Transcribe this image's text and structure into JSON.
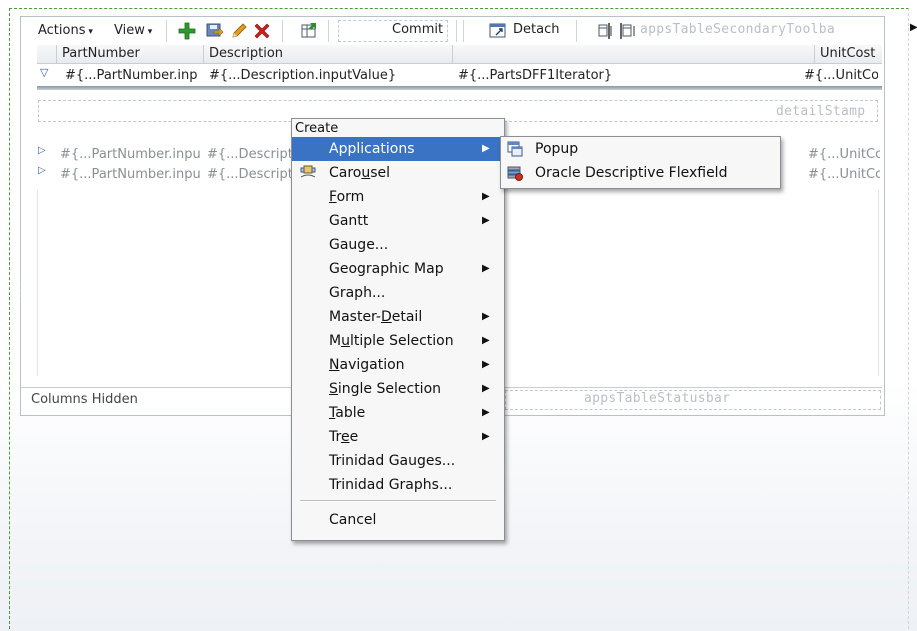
{
  "toolbar": {
    "actions_label": "Actions",
    "view_label": "View",
    "commit_label": "Commit",
    "detach_label": "Detach",
    "secondary_toolbar_label": "appsTableSecondaryToolba"
  },
  "table": {
    "columns": [
      "PartNumber",
      "Description",
      "",
      "UnitCost"
    ],
    "master_row": {
      "part": "#{...PartNumber.inp",
      "desc": "#{...Description.inputValue}",
      "iter": "#{...PartsDFF1Iterator}",
      "cost": "#{...UnitCo"
    },
    "detail_stamp_label": "detailStamp",
    "rows": [
      {
        "part": "#{...PartNumber.inpu",
        "desc": "#{...Descript",
        "cost": "#{...UnitCos"
      },
      {
        "part": "#{...PartNumber.inpu",
        "desc": "#{...Descript",
        "cost": "#{...UnitCos"
      }
    ],
    "status_left": "Columns Hidden",
    "statusbar_label": "appsTableStatusbar"
  },
  "context_menu": {
    "title": "Create",
    "items": [
      {
        "label": "Applications",
        "submenu": true,
        "selected": true
      },
      {
        "label": "Carousel",
        "submenu": false,
        "icon": "carousel-icon"
      },
      {
        "label": "Form",
        "submenu": true
      },
      {
        "label": "Gantt",
        "submenu": true
      },
      {
        "label": "Gauge...",
        "submenu": false
      },
      {
        "label": "Geographic Map",
        "submenu": true
      },
      {
        "label": "Graph...",
        "submenu": false
      },
      {
        "label": "Master-Detail",
        "submenu": true
      },
      {
        "label": "Multiple Selection",
        "submenu": true
      },
      {
        "label": "Navigation",
        "submenu": true
      },
      {
        "label": "Single Selection",
        "submenu": true
      },
      {
        "label": "Table",
        "submenu": true
      },
      {
        "label": "Tree",
        "submenu": true
      },
      {
        "label": "Trinidad Gauges...",
        "submenu": false
      },
      {
        "label": "Trinidad Graphs...",
        "submenu": false
      }
    ],
    "cancel_label": "Cancel"
  },
  "submenu": {
    "items": [
      {
        "label": "Popup",
        "icon": "popup-icon"
      },
      {
        "label": "Oracle Descriptive Flexfield",
        "icon": "flexfield-icon"
      }
    ]
  },
  "colors": {
    "selection": "#3a73c4",
    "add": "#2e9a2e",
    "delete": "#d0201c",
    "edit": "#d9911a"
  }
}
